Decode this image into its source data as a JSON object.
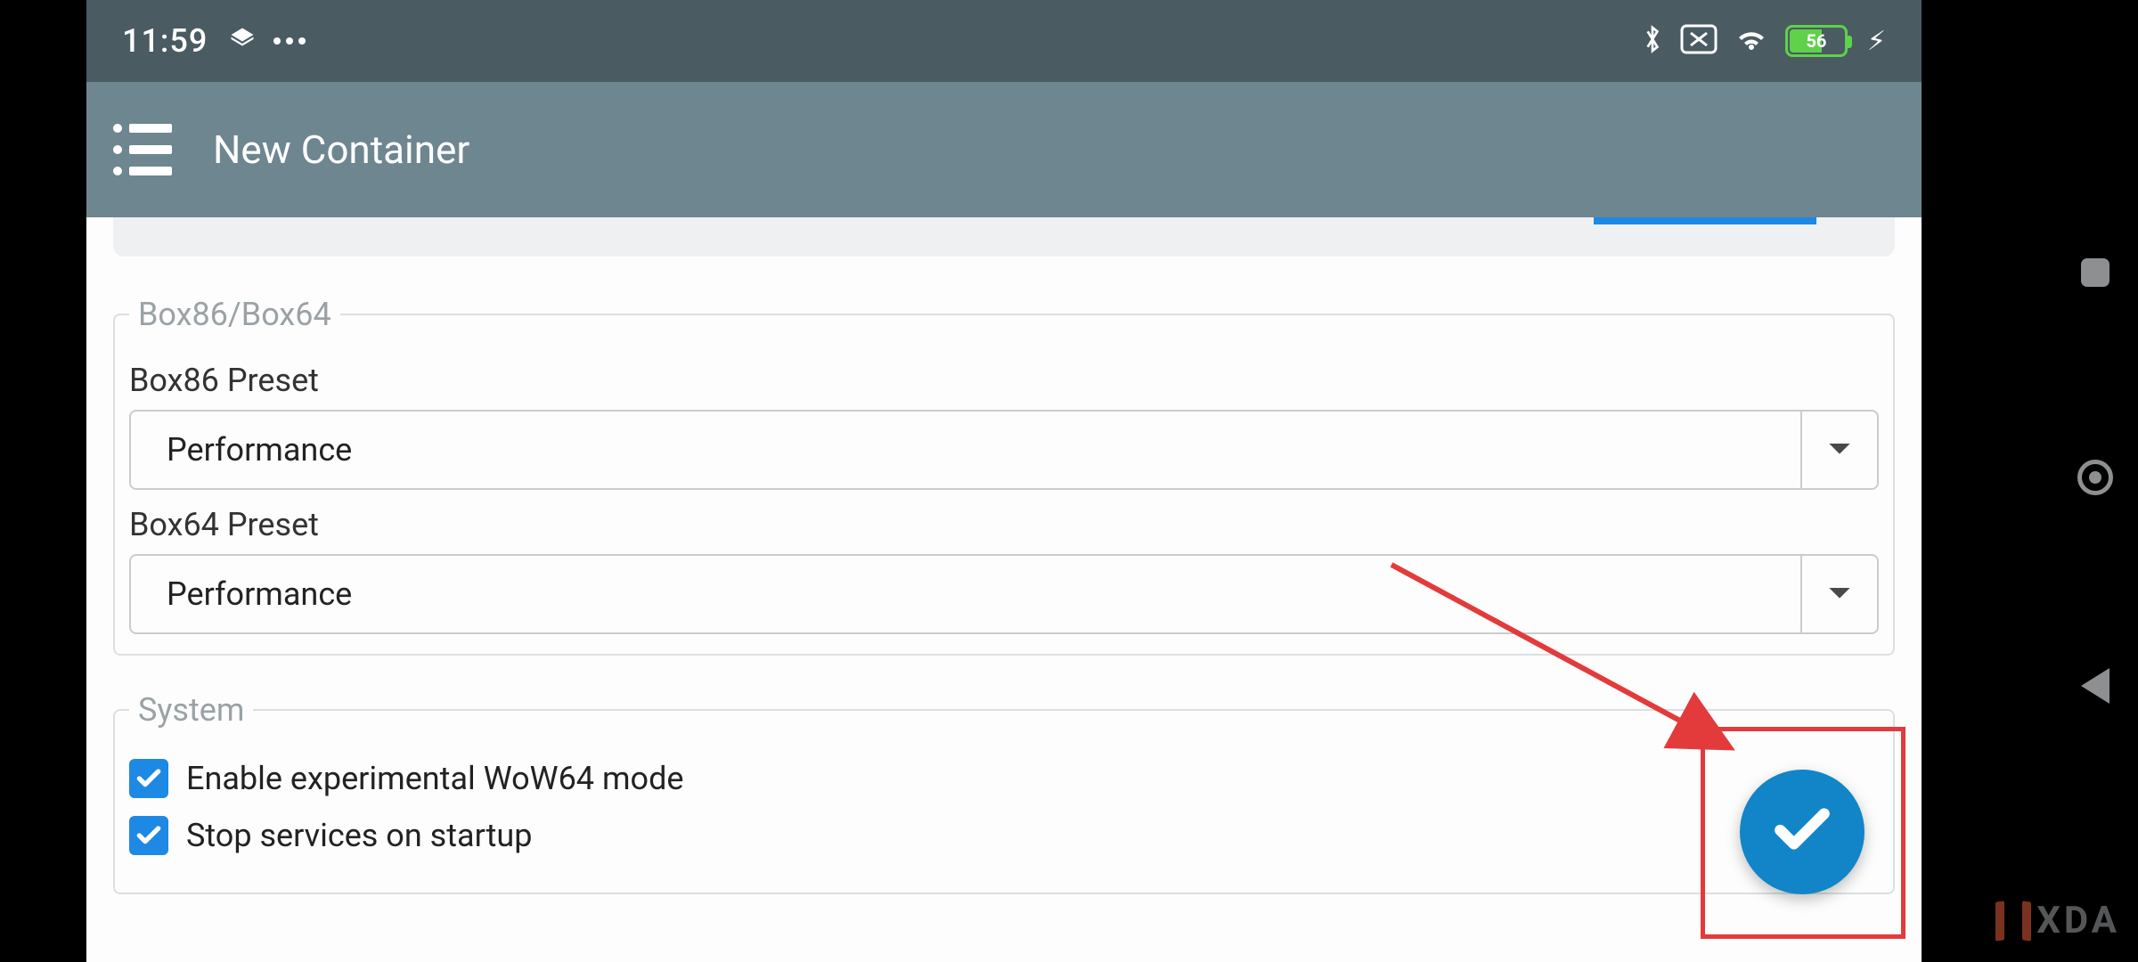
{
  "status": {
    "time": "11:59",
    "battery_pct": "56"
  },
  "appbar": {
    "title": "New Container"
  },
  "section_box": {
    "legend": "Box86/Box64",
    "box86_label": "Box86 Preset",
    "box86_value": "Performance",
    "box64_label": "Box64 Preset",
    "box64_value": "Performance"
  },
  "section_system": {
    "legend": "System",
    "wow64_label": "Enable experimental WoW64 mode",
    "wow64_checked": true,
    "stop_services_label": "Stop services on startup",
    "stop_services_checked": true
  },
  "watermark": {
    "text": "XDA"
  }
}
